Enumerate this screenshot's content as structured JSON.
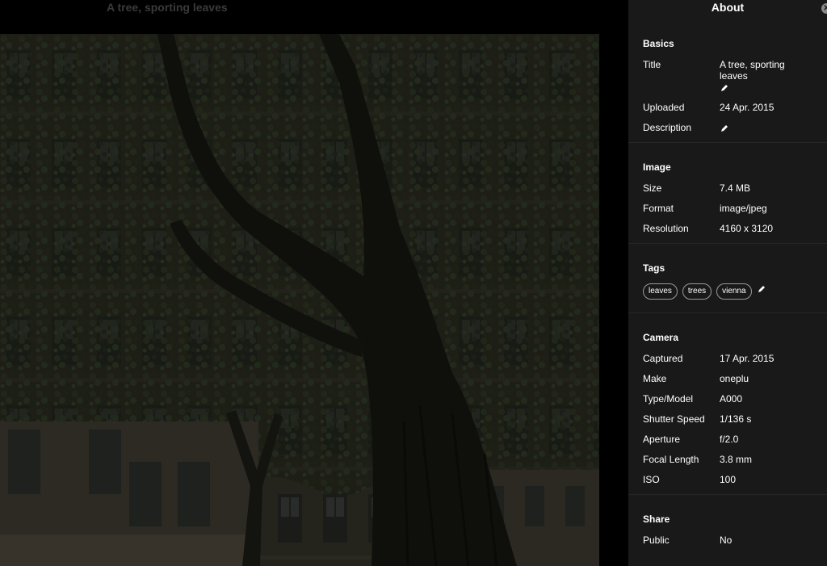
{
  "viewer": {
    "photo_title": "A tree, sporting leaves"
  },
  "sidebar": {
    "title": "About",
    "close_icon": "close-icon",
    "basics": {
      "heading": "Basics",
      "title_label": "Title",
      "title_value": "A tree, sporting leaves",
      "uploaded_label": "Uploaded",
      "uploaded_value": "24 Apr. 2015",
      "description_label": "Description",
      "description_value": ""
    },
    "image": {
      "heading": "Image",
      "size_label": "Size",
      "size_value": "7.4 MB",
      "format_label": "Format",
      "format_value": "image/jpeg",
      "resolution_label": "Resolution",
      "resolution_value": "4160 x 3120"
    },
    "tags": {
      "heading": "Tags",
      "items": [
        "leaves",
        "trees",
        "vienna"
      ]
    },
    "camera": {
      "heading": "Camera",
      "captured_label": "Captured",
      "captured_value": "17 Apr. 2015",
      "make_label": "Make",
      "make_value": "oneplu",
      "model_label": "Type/Model",
      "model_value": "A000",
      "shutter_label": "Shutter Speed",
      "shutter_value": "1/136 s",
      "aperture_label": "Aperture",
      "aperture_value": "f/2.0",
      "focal_label": "Focal Length",
      "focal_value": "3.8 mm",
      "iso_label": "ISO",
      "iso_value": "100"
    },
    "share": {
      "heading": "Share",
      "public_label": "Public",
      "public_value": "No"
    }
  },
  "colors": {
    "sidebar_bg": "#191919",
    "viewer_bg": "#000000",
    "photo_foliage": "#2a3320",
    "photo_building": "#3d3a30",
    "photo_trunk": "#15140f"
  }
}
